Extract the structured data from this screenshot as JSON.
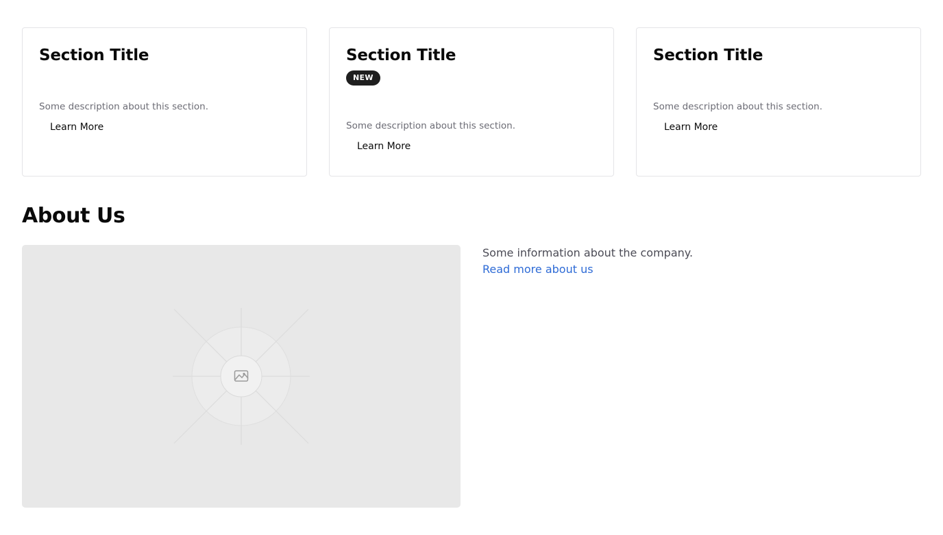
{
  "cards": [
    {
      "title": "Section Title",
      "badge": "",
      "description": "Some description about this section.",
      "link": "Learn More"
    },
    {
      "title": "Section Title",
      "badge": "NEW",
      "description": "Some description about this section.",
      "link": "Learn More"
    },
    {
      "title": "Section Title",
      "badge": "",
      "description": "Some description about this section.",
      "link": "Learn More"
    }
  ],
  "about": {
    "title": "About Us",
    "info": "Some information about the company.",
    "link": "Read more about us",
    "image_icon": "image-placeholder-icon"
  },
  "colors": {
    "badge_bg": "#1f1f1f",
    "link_blue": "#2e6bd6",
    "placeholder_bg": "#e8e8e8"
  }
}
